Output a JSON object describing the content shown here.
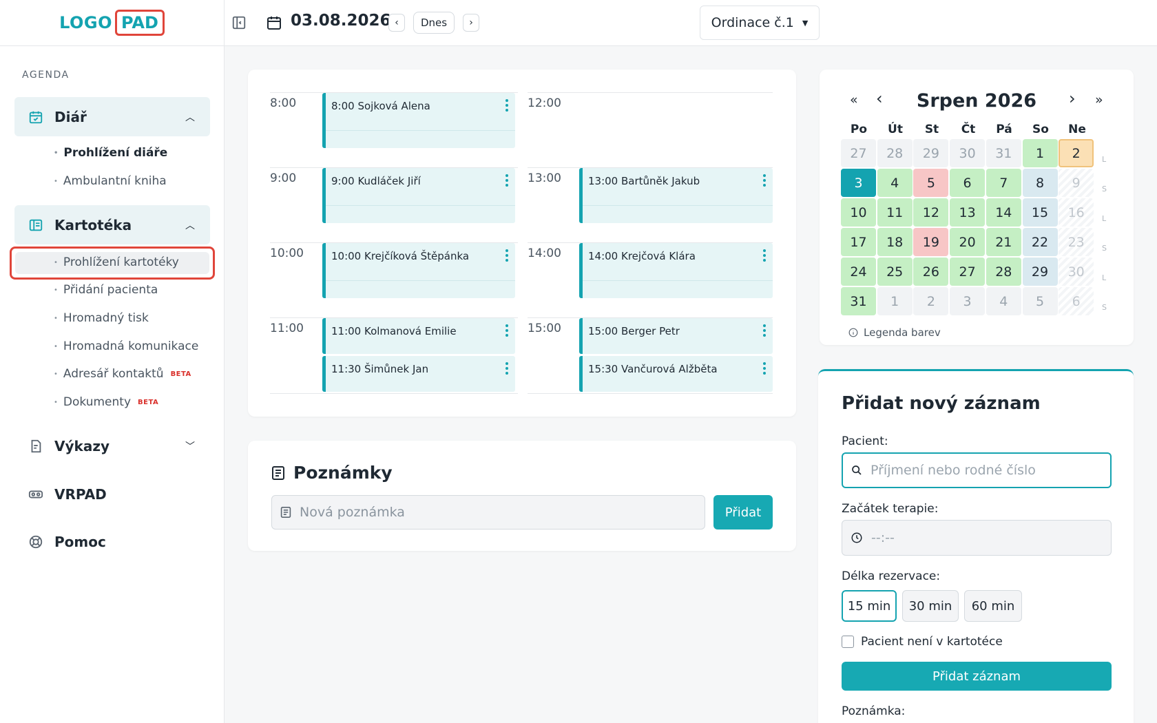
{
  "logo": {
    "text": "LOGO",
    "box": "PAD"
  },
  "sidebar": {
    "section_label": "AGENDA",
    "diar": {
      "label": "Diář",
      "items": [
        "Prohlížení diáře",
        "Ambulantní kniha"
      ]
    },
    "kartoteka": {
      "label": "Kartotéka",
      "items": [
        "Prohlížení kartotéky",
        "Přidání pacienta",
        "Hromadný tisk",
        "Hromadná komunikace",
        "Adresář kontaktů",
        "Dokumenty"
      ],
      "beta": "BETA"
    },
    "vykazy": {
      "label": "Výkazy"
    },
    "vrpad": {
      "label": "VRPAD"
    },
    "pomoc": {
      "label": "Pomoc"
    }
  },
  "topbar": {
    "date": "03.08.2026",
    "today_label": "Dnes",
    "clinic": "Ordinace č.1"
  },
  "schedule": {
    "times": [
      "8:00",
      "9:00",
      "10:00",
      "11:00",
      "12:00",
      "13:00",
      "14:00",
      "15:00"
    ],
    "appointments": [
      "8:00  Sojková Alena",
      "9:00  Kudláček Jiří",
      "10:00  Krejčíková Štěpánka",
      "11:00  Kolmanová Emilie",
      "11:30  Šimůnek Jan",
      "13:00  Bartůněk Jakub",
      "14:00  Krejčová Klára",
      "15:00  Berger Petr",
      "15:30  Vančurová Alžběta"
    ]
  },
  "notes": {
    "title": "Poznámky",
    "placeholder": "Nová poznámka",
    "add_label": "Přidat"
  },
  "calendar": {
    "title": "Srpen 2026",
    "nav": {
      "first": "«",
      "prev": "‹",
      "next": "›",
      "last": "»"
    },
    "weekdays": [
      "Po",
      "Út",
      "St",
      "Čt",
      "Pá",
      "So",
      "Ne"
    ],
    "days": [
      "27",
      "28",
      "29",
      "30",
      "31",
      "1",
      "2",
      "3",
      "4",
      "5",
      "6",
      "7",
      "8",
      "9",
      "10",
      "11",
      "12",
      "13",
      "14",
      "15",
      "16",
      "17",
      "18",
      "19",
      "20",
      "21",
      "22",
      "23",
      "24",
      "25",
      "26",
      "27",
      "28",
      "29",
      "30",
      "31",
      "1",
      "2",
      "3",
      "4",
      "5",
      "6"
    ],
    "week_marks": [
      "L",
      "S",
      "L",
      "S",
      "L",
      "S"
    ],
    "legend": "Legenda barev",
    "colors": {
      "today": "#14a3b0",
      "green": "#c5efc4",
      "red": "#f7c6c6",
      "blue": "#d9e9f0",
      "orange": "#fbe0b5"
    }
  },
  "form": {
    "title": "Přidat nový záznam",
    "patient_label": "Pacient:",
    "patient_placeholder": "Příjmení nebo rodné číslo",
    "start_label": "Začátek terapie:",
    "start_placeholder": "--:--",
    "duration_label": "Délka rezervace:",
    "durations": [
      "15 min",
      "30 min",
      "60 min"
    ],
    "checkbox_label": "Pacient není v kartotéce",
    "submit_label": "Přidat záznam",
    "note_label": "Poznámka:"
  }
}
